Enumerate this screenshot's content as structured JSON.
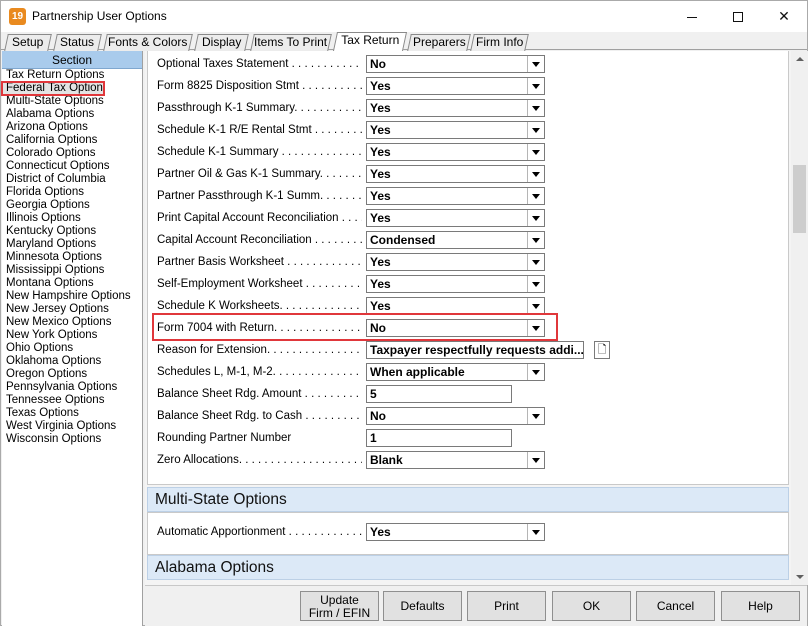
{
  "window": {
    "app_icon_text": "19",
    "title": "Partnership User Options",
    "minimize_label": "",
    "close_label": "✕"
  },
  "tabs": [
    {
      "label": "Setup",
      "active": false
    },
    {
      "label": "Status",
      "active": false
    },
    {
      "label": "Fonts & Colors",
      "active": false
    },
    {
      "label": "Display",
      "active": false
    },
    {
      "label": "Items To Print",
      "active": false
    },
    {
      "label": "Tax Return",
      "active": true
    },
    {
      "label": "Preparers",
      "active": false
    },
    {
      "label": "Firm Info",
      "active": false
    }
  ],
  "sidebar": {
    "header": "Section",
    "selected_index": 1,
    "items": [
      "Tax Return Options",
      "Federal Tax Options",
      "Multi-State Options",
      "Alabama Options",
      "Arizona Options",
      "California Options",
      "Colorado Options",
      "Connecticut Options",
      "District of Columbia",
      "Florida Options",
      "Georgia Options",
      "Illinois Options",
      "Kentucky Options",
      "Maryland Options",
      "Minnesota Options",
      "Mississippi Options",
      "Montana Options",
      "New Hampshire Options",
      "New Jersey Options",
      "New Mexico Options",
      "New York Options",
      "Ohio Options",
      "Oklahoma Options",
      "Oregon Options",
      "Pennsylvania Options",
      "Tennessee Options",
      "Texas Options",
      "West Virginia Options",
      "Wisconsin Options"
    ]
  },
  "federal_options": [
    {
      "label": "Optional Taxes Statement . . . . . . . . . . . .",
      "value": "No",
      "kind": "select"
    },
    {
      "label": "Form 8825 Disposition Stmt . . . . . . . . . .",
      "value": "Yes",
      "kind": "select"
    },
    {
      "label": "Passthrough K-1 Summary. . . . . . . . . . . .",
      "value": "Yes",
      "kind": "select"
    },
    {
      "label": "Schedule K-1 R/E Rental Stmt . . . . . . . . .",
      "value": "Yes",
      "kind": "select"
    },
    {
      "label": "Schedule K-1 Summary . . . . . . . . . . . . . .",
      "value": "Yes",
      "kind": "select"
    },
    {
      "label": "Partner Oil & Gas K-1 Summary. . . . . . . .",
      "value": "Yes",
      "kind": "select"
    },
    {
      "label": "Partner Passthrough K-1 Summ. . . . . . . .",
      "value": "Yes",
      "kind": "select"
    },
    {
      "label": "Print Capital Account Reconciliation . . . . .",
      "value": "Yes",
      "kind": "select"
    },
    {
      "label": "Capital Account Reconciliation . . . . . . . . .",
      "value": "Condensed",
      "kind": "select"
    },
    {
      "label": "Partner Basis Worksheet . . . . . . . . . . . . .",
      "value": "Yes",
      "kind": "select"
    },
    {
      "label": "Self-Employment Worksheet . . . . . . . . . . .",
      "value": "Yes",
      "kind": "select"
    },
    {
      "label": "Schedule K Worksheets. . . . . . . . . . . . . .",
      "value": "Yes",
      "kind": "select"
    },
    {
      "label": "Form 7004 with Return. . . . . . . . . . . . . . .",
      "value": "No",
      "kind": "select",
      "highlighted": true
    },
    {
      "label": "Reason for Extension. . . . . . . . . . . . . . . .",
      "value": "Taxpayer respectfully requests addi...",
      "kind": "long"
    },
    {
      "label": "Schedules L, M-1, M-2. . . . . . . . . . . . . . .",
      "value": "When applicable",
      "kind": "select"
    },
    {
      "label": "Balance Sheet Rdg. Amount . . . . . . . . . . .",
      "value": "5",
      "kind": "text"
    },
    {
      "label": "Balance Sheet Rdg. to Cash . . . . . . . . . . .",
      "value": "No",
      "kind": "select"
    },
    {
      "label": "Rounding Partner Number",
      "value": "1",
      "kind": "text"
    },
    {
      "label": "Zero Allocations. . . . . . . . . . . . . . . . . . . .",
      "value": "Blank",
      "kind": "select"
    }
  ],
  "multistate": {
    "header": "Multi-State Options",
    "options": [
      {
        "label": "Automatic Apportionment . . . . . . . . . . . .",
        "value": "Yes",
        "kind": "select"
      }
    ]
  },
  "alabama": {
    "header": "Alabama Options"
  },
  "buttons": {
    "update_line1": "Update",
    "update_line2": "Firm / EFIN",
    "defaults": "Defaults",
    "print": "Print",
    "ok": "OK",
    "cancel": "Cancel",
    "help": "Help"
  }
}
